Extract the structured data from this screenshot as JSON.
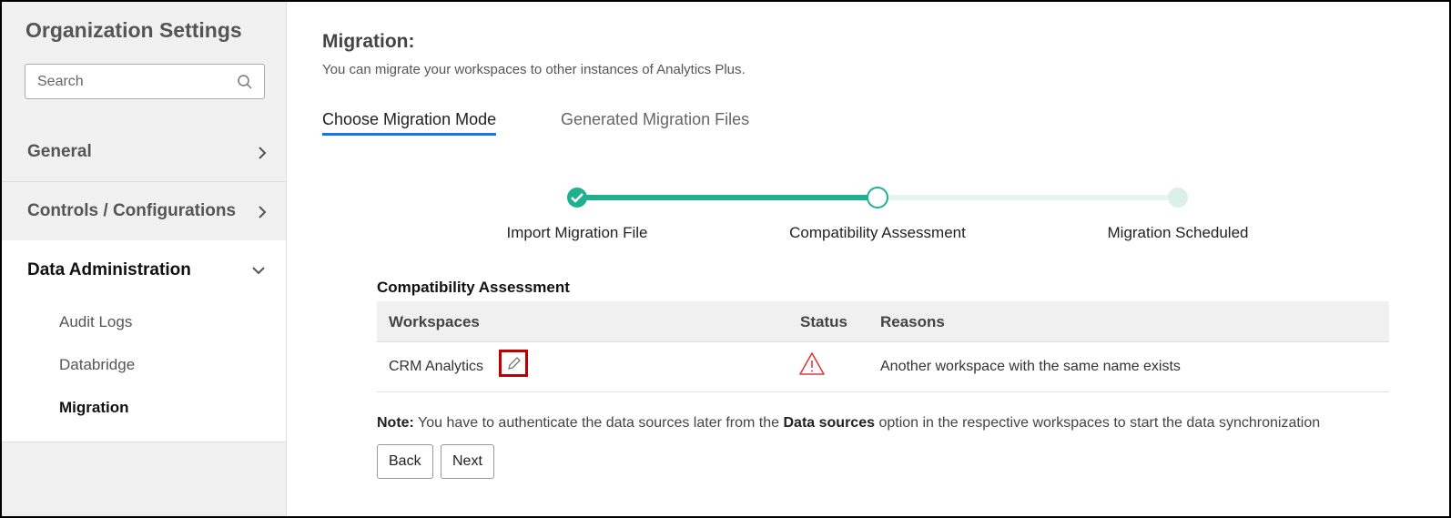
{
  "sidebar": {
    "title": "Organization Settings",
    "search_placeholder": "Search",
    "items": [
      {
        "label": "General"
      },
      {
        "label": "Controls / Configurations"
      },
      {
        "label": "Data Administration"
      }
    ],
    "sub_items": [
      {
        "label": "Audit Logs"
      },
      {
        "label": "Databridge"
      },
      {
        "label": "Migration"
      }
    ]
  },
  "main": {
    "title": "Migration:",
    "description": "You can migrate your workspaces to other instances of Analytics Plus.",
    "tabs": [
      {
        "label": "Choose Migration Mode"
      },
      {
        "label": "Generated Migration Files"
      }
    ],
    "steps": [
      {
        "label": "Import Migration File",
        "state": "done"
      },
      {
        "label": "Compatibility Assessment",
        "state": "current"
      },
      {
        "label": "Migration Scheduled",
        "state": "pending"
      }
    ],
    "section_title": "Compatibility Assessment",
    "table": {
      "headers": [
        "Workspaces",
        "Status",
        "Reasons"
      ],
      "rows": [
        {
          "workspace": "CRM Analytics",
          "status": "warning",
          "reason": "Another workspace with the same name exists"
        }
      ]
    },
    "note": {
      "prefix": "Note:",
      "text1": " You have to authenticate the data sources later from the ",
      "bold": "Data sources",
      "text2": " option in the respective workspaces to start the data synchronization"
    },
    "buttons": {
      "back": "Back",
      "next": "Next"
    }
  },
  "colors": {
    "accent": "#1fb08f",
    "tab_underline": "#1a73e8",
    "warning": "#e03a3a",
    "highlight": "#c00000"
  }
}
